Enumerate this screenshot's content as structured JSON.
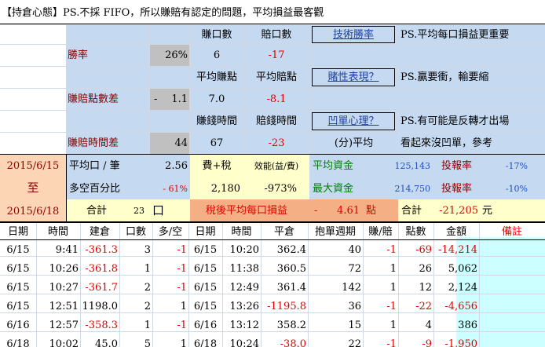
{
  "header": {
    "title": "【持倉心態】PS.不採 FIFO，所以賺賠有認定的問題，平均損益最客觀"
  },
  "top": {
    "col_win_count": "賺口數",
    "col_loss_count": "賠口數",
    "btn_tech_winrate": "技術勝率",
    "note1": "PS.平均每口損益更重要",
    "winrate_label": "勝率",
    "winrate_value": "26%",
    "win_count": "6",
    "loss_count": "-17",
    "avg_win_label": "平均賺點",
    "avg_loss_label": "平均賠點",
    "btn_gambling": "賭性表現？",
    "note2": "PS.贏要衝，輸要縮",
    "point_diff_label": "賺賠點數差",
    "point_diff_sign": "-",
    "point_diff_value": "1.1",
    "avg_win_pts": "7.0",
    "avg_loss_pts": "-8.1",
    "win_time_label": "賺錢時間",
    "loss_time_label": "賠錢時間",
    "btn_dip": "凹單心理？",
    "note3": "PS.有可能是反轉才出場",
    "time_diff_label": "賺賠時間差",
    "time_diff_value": "44",
    "win_time": "67",
    "loss_time": "-23",
    "avg_min_label": "(分)平均",
    "note4": "看起來沒凹單，參考"
  },
  "summary": {
    "date_from": "2015/6/15",
    "date_to_label": "至",
    "date_to": "2015/6/18",
    "avg_per_lot_label": "平均口 / 筆",
    "avg_per_lot": "2.56",
    "fee_tax_label": "費+稅",
    "efficiency_label": "效能(益/費)",
    "avg_capital_label": "平均資金",
    "avg_capital": "125,143",
    "roi_label": "投報率",
    "roi1": "-17%",
    "long_short_label": "多空百分比",
    "long_short_pct": "- 61%",
    "fee_tax": "2,180",
    "efficiency": "-973%",
    "max_capital_label": "最大資金",
    "max_capital": "214,750",
    "roi2": "-10%",
    "total_label": "合計",
    "total_lots": "23",
    "lots_unit": "口",
    "after_tax_label": "稅後平均每口損益",
    "after_tax_sign": "-",
    "after_tax_value": "4.61",
    "after_tax_unit": "點",
    "total_amount_label": "合計",
    "total_amount": "-21,205",
    "total_amount_unit": "元"
  },
  "table": {
    "headers": [
      "日期",
      "時間",
      "建倉",
      "口數",
      "多/空",
      "日期",
      "時間",
      "平倉",
      "抱單週期",
      "賺/賠",
      "點數",
      "金額",
      "備註"
    ],
    "rows": [
      [
        "6/15",
        "9:41",
        "-361.3",
        "3",
        "-1",
        "6/15",
        "10:20",
        "362.4",
        "40",
        "-1",
        "-69",
        "-14,214",
        ""
      ],
      [
        "6/15",
        "10:26",
        "-361.8",
        "1",
        "-1",
        "6/15",
        "11:38",
        "360.5",
        "72",
        "1",
        "26",
        "5,062",
        ""
      ],
      [
        "6/15",
        "10:27",
        "-361.7",
        "2",
        "-1",
        "6/15",
        "12:49",
        "361.4",
        "142",
        "1",
        "12",
        "2,124",
        ""
      ],
      [
        "6/15",
        "12:51",
        "1198.0",
        "2",
        "1",
        "6/15",
        "13:26",
        "-1195.8",
        "36",
        "-1",
        "-22",
        "-4,656",
        ""
      ],
      [
        "6/16",
        "12:57",
        "-358.3",
        "1",
        "-1",
        "6/16",
        "13:12",
        "358.2",
        "15",
        "1",
        "4",
        "386",
        ""
      ],
      [
        "6/18",
        "10:02",
        "45.0",
        "5",
        "1",
        "6/18",
        "10:24",
        "-38.0",
        "22",
        "-1",
        "-9",
        "-1,950",
        ""
      ]
    ]
  },
  "colors": {
    "band_blue": "#c5d9f1",
    "band_gray": "#c0c0c0",
    "band_orange": "#fcd5b4",
    "band_yellow": "#ffffcc",
    "band_salmon": "#f4b084",
    "band_cyan": "#ccffff",
    "accent_red": "#e00000",
    "accent_blue": "#1f4fbf"
  }
}
